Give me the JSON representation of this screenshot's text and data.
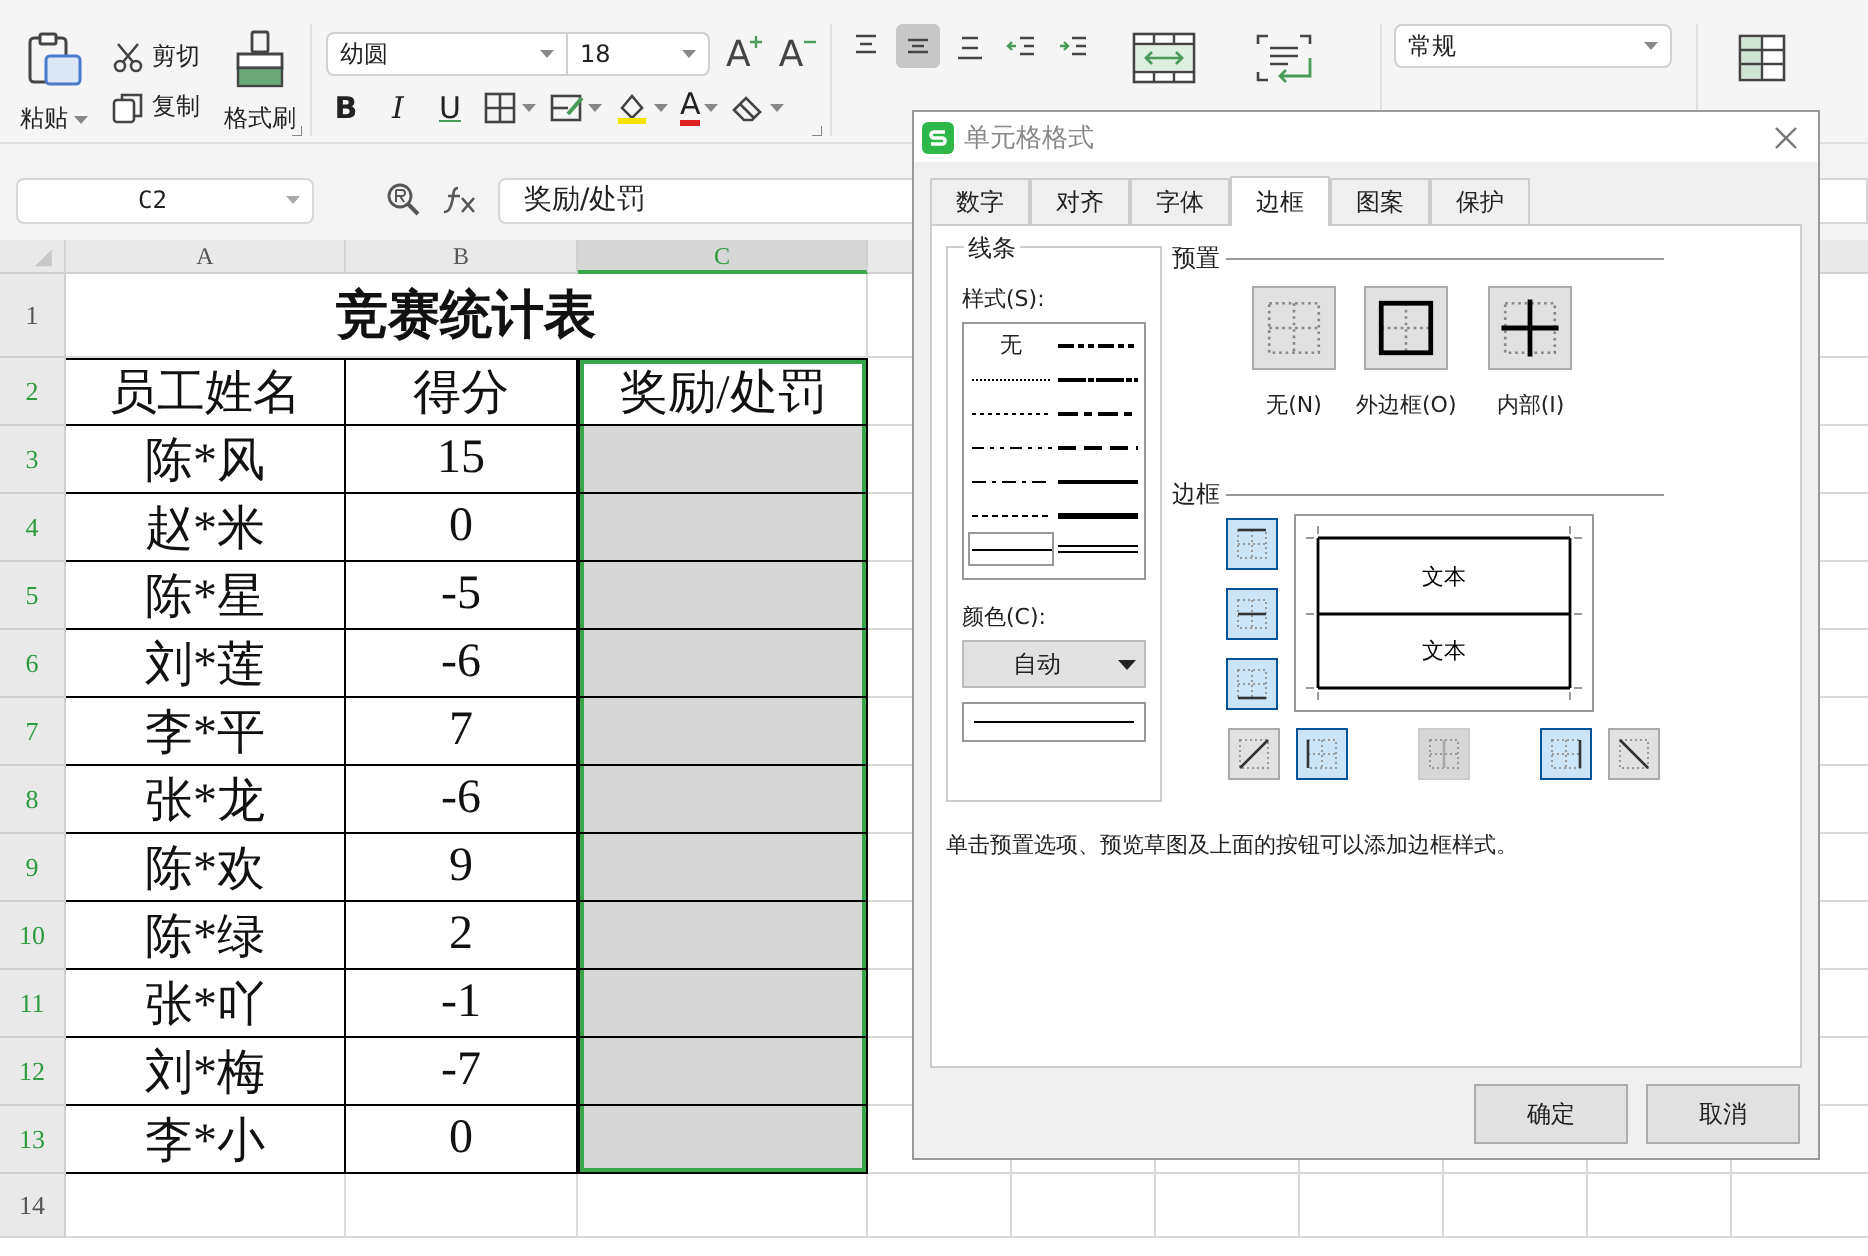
{
  "ribbon": {
    "paste": "粘贴",
    "cut": "剪切",
    "copy": "复制",
    "format_painter": "格式刷",
    "font_name": "幼圆",
    "font_size": "18",
    "size_buttons": [
      {
        "label": "A",
        "kind": "grow"
      },
      {
        "label": "A",
        "kind": "shrink"
      }
    ],
    "style_buttons": [
      {
        "label": "B",
        "kind": "bold"
      },
      {
        "label": "I",
        "kind": "italic"
      },
      {
        "label": "U",
        "kind": "underline"
      }
    ],
    "font_color": "A",
    "align_buttons": [
      {
        "kind": "top",
        "selected": false
      },
      {
        "kind": "middle",
        "selected": true
      },
      {
        "kind": "bottom",
        "selected": false
      },
      {
        "kind": "outdent",
        "selected": false
      },
      {
        "kind": "indent",
        "selected": false
      }
    ],
    "number_format": "常规"
  },
  "formula_bar": {
    "name_box": "C2",
    "formula": "奖励/处罚"
  },
  "sheet": {
    "columns": [
      {
        "label": "A",
        "selected": false
      },
      {
        "label": "B",
        "selected": false
      },
      {
        "label": "C",
        "selected": true
      }
    ],
    "row_numbers": [
      {
        "label": "1",
        "selected": false
      },
      {
        "label": "2",
        "selected": true
      },
      {
        "label": "3",
        "selected": true
      },
      {
        "label": "4",
        "selected": true
      },
      {
        "label": "5",
        "selected": true
      },
      {
        "label": "6",
        "selected": true
      },
      {
        "label": "7",
        "selected": true
      },
      {
        "label": "8",
        "selected": true
      },
      {
        "label": "9",
        "selected": true
      },
      {
        "label": "10",
        "selected": true
      },
      {
        "label": "11",
        "selected": true
      },
      {
        "label": "12",
        "selected": true
      },
      {
        "label": "13",
        "selected": true
      },
      {
        "label": "14",
        "selected": false
      }
    ],
    "title": "竞赛统计表",
    "header": [
      "员工姓名",
      "得分",
      "奖励/处罚"
    ],
    "rows": [
      {
        "name": "陈*风",
        "score": "15"
      },
      {
        "name": "赵*米",
        "score": "0"
      },
      {
        "name": "陈*星",
        "score": "-5"
      },
      {
        "name": "刘*莲",
        "score": "-6"
      },
      {
        "name": "李*平",
        "score": "7"
      },
      {
        "name": "张*龙",
        "score": "-6"
      },
      {
        "name": "陈*欢",
        "score": "9"
      },
      {
        "name": "陈*绿",
        "score": "2"
      },
      {
        "name": "张*吖",
        "score": "-1"
      },
      {
        "name": "刘*梅",
        "score": "-7"
      },
      {
        "name": "李*小",
        "score": "0"
      }
    ]
  },
  "dialog": {
    "title": "单元格格式",
    "tabs": [
      {
        "label": "数字",
        "selected": false
      },
      {
        "label": "对齐",
        "selected": false
      },
      {
        "label": "字体",
        "selected": false
      },
      {
        "label": "边框",
        "selected": true
      },
      {
        "label": "图案",
        "selected": false
      },
      {
        "label": "保护",
        "selected": false
      }
    ],
    "line_group": {
      "title": "线条",
      "style_label": "样式(S):",
      "styles": [
        {
          "kind": "none",
          "label": "无",
          "selected": false
        },
        {
          "kind": "medium-dash-dot-dot",
          "selected": false
        },
        {
          "kind": "hair",
          "selected": false
        },
        {
          "kind": "slanted-dash-dot",
          "selected": false
        },
        {
          "kind": "dotted",
          "selected": false
        },
        {
          "kind": "medium-dash-dot",
          "selected": false
        },
        {
          "kind": "dash-dot-dot",
          "selected": false
        },
        {
          "kind": "medium-dashed",
          "selected": false
        },
        {
          "kind": "dash-dot",
          "selected": false
        },
        {
          "kind": "medium",
          "selected": false
        },
        {
          "kind": "dashed",
          "selected": false
        },
        {
          "kind": "thick",
          "selected": false
        },
        {
          "kind": "thin",
          "selected": true
        },
        {
          "kind": "double",
          "selected": false
        }
      ],
      "color_label": "颜色(C):",
      "color_value": "自动"
    },
    "preset_title": "预置",
    "presets": [
      {
        "kind": "none",
        "label": "无(N)"
      },
      {
        "kind": "outline",
        "label": "外边框(O)"
      },
      {
        "kind": "inside",
        "label": "内部(I)"
      }
    ],
    "border_title": "边框",
    "side_buttons": [
      {
        "kind": "top",
        "on": true,
        "disabled": false
      },
      {
        "kind": "middle",
        "on": true,
        "disabled": false
      },
      {
        "kind": "bottom",
        "on": true,
        "disabled": false
      }
    ],
    "bottom_buttons": [
      {
        "kind": "diag-up",
        "on": false,
        "disabled": false
      },
      {
        "kind": "left",
        "on": true,
        "disabled": false
      },
      {
        "kind": "vertical",
        "on": false,
        "disabled": true
      },
      {
        "kind": "right",
        "on": true,
        "disabled": false
      },
      {
        "kind": "diag-down",
        "on": false,
        "disabled": false
      }
    ],
    "preview_texts": [
      "文本",
      "文本"
    ],
    "hint": "单击预置选项、预览草图及上面的按钮可以添加边框样式。",
    "buttons": [
      "确定",
      "取消"
    ]
  }
}
